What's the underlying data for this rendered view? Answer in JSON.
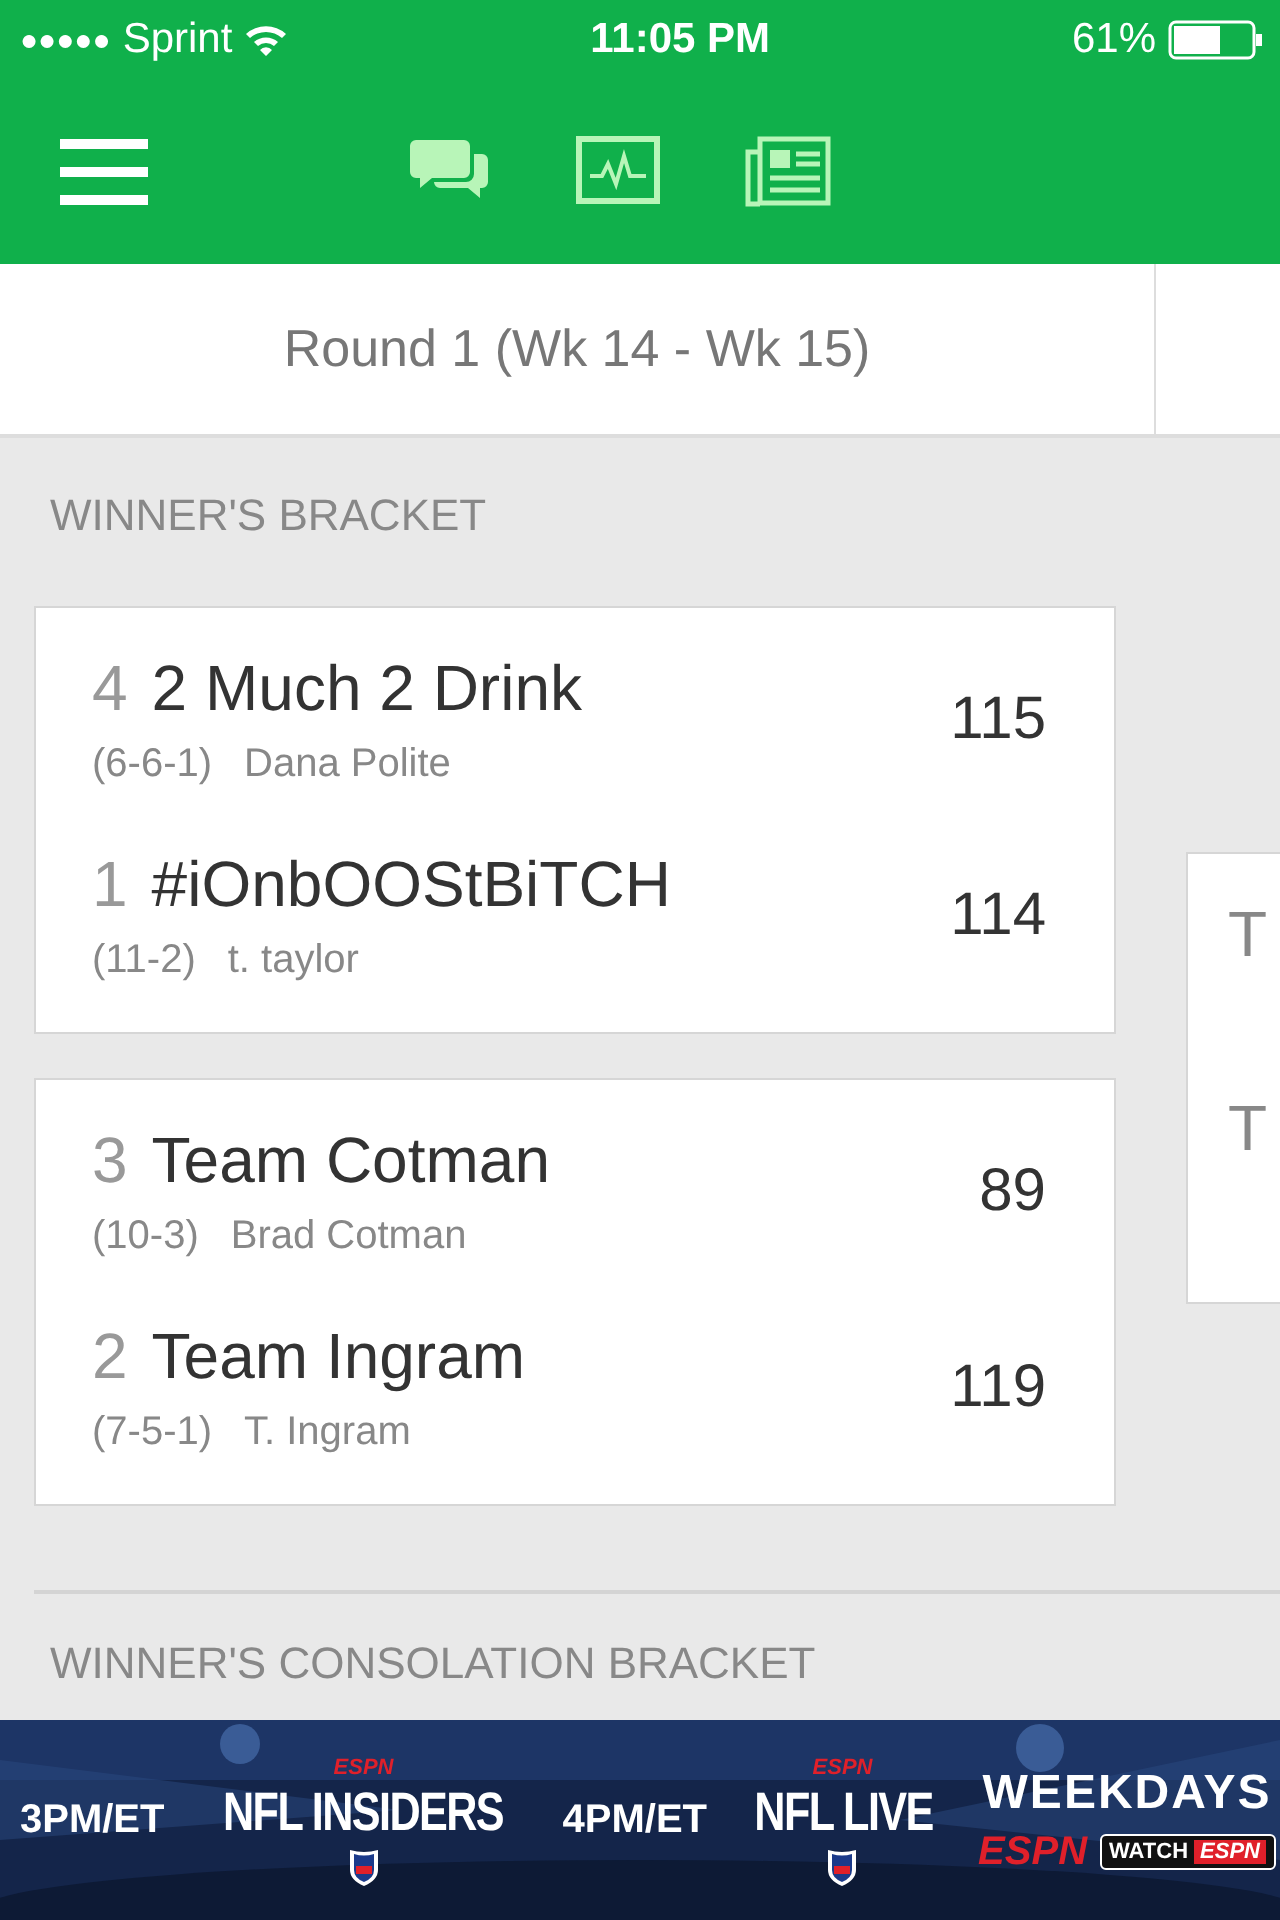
{
  "status_bar": {
    "signal_dots": "●●●●●",
    "carrier": "Sprint",
    "time": "11:05 PM",
    "battery": "61%"
  },
  "header": {
    "icons": [
      {
        "kind": "chat"
      },
      {
        "kind": "activity"
      },
      {
        "kind": "news"
      }
    ]
  },
  "round_tabs": [
    {
      "label": "Round 1 (Wk 14 - Wk 15)"
    }
  ],
  "sections": [
    {
      "title": "WINNER'S BRACKET"
    }
  ],
  "matchups": [
    {
      "teams": [
        {
          "seed": "4",
          "name": "2 Much 2 Drink",
          "record": "(6-6-1)",
          "owner": "Dana Polite",
          "score": "115"
        },
        {
          "seed": "1",
          "name": "#iOnbOOStBiTCH",
          "record": "(11-2)",
          "owner": "t. taylor",
          "score": "114"
        }
      ]
    },
    {
      "teams": [
        {
          "seed": "3",
          "name": "Team Cotman",
          "record": "(10-3)",
          "owner": "Brad Cotman",
          "score": "89"
        },
        {
          "seed": "2",
          "name": "Team Ingram",
          "record": "(7-5-1)",
          "owner": "T. Ingram",
          "score": "119"
        }
      ]
    }
  ],
  "next_round": {
    "teams": [
      {
        "name": "T"
      },
      {
        "name": "T"
      }
    ]
  },
  "next_section": {
    "title": "WINNER'S CONSOLATION BRACKET"
  },
  "ad_banner": {
    "items": [
      {
        "time": "3PM/ET",
        "network": "ESPN",
        "show": "NFL INSIDERS"
      },
      {
        "time": "4PM/ET",
        "network": "ESPN",
        "show": "NFL LIVE"
      }
    ],
    "tagline": "WEEKDAYS",
    "network": "ESPN",
    "watch_label": "WATCH",
    "watch_network": "ESPN"
  }
}
